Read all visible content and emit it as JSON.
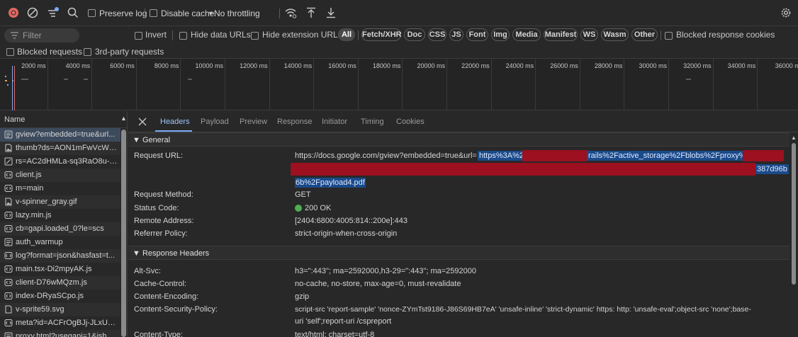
{
  "toolbar": {
    "preserve_log": "Preserve log",
    "disable_cache": "Disable cache",
    "throttling": "No throttling",
    "icons": [
      "record-stop-icon",
      "clear-icon",
      "filter-settings-icon",
      "search-icon",
      "network-conditions-icon",
      "import-har-icon",
      "export-har-icon",
      "settings-icon"
    ],
    "colors": {
      "record": "#e46962",
      "accent": "#7cacf8"
    }
  },
  "filter": {
    "placeholder": "Filter",
    "invert": "Invert",
    "hide_data_urls": "Hide data URLs",
    "hide_extension_urls": "Hide extension URLs",
    "types": [
      "All",
      "Fetch/XHR",
      "Doc",
      "CSS",
      "JS",
      "Font",
      "Img",
      "Media",
      "Manifest",
      "WS",
      "Wasm",
      "Other"
    ],
    "active_type": "All",
    "blocked_response_cookies": "Blocked response cookies",
    "blocked_requests": "Blocked requests",
    "third_party": "3rd-party requests"
  },
  "timeline": {
    "ticks": [
      "2000 ms",
      "4000 ms",
      "6000 ms",
      "8000 ms",
      "10000 ms",
      "12000 ms",
      "14000 ms",
      "16000 ms",
      "18000 ms",
      "20000 ms",
      "22000 ms",
      "24000 ms",
      "26000 ms",
      "28000 ms",
      "30000 ms",
      "32000 ms",
      "34000 ms",
      "36000 m"
    ]
  },
  "requests": {
    "header": "Name",
    "items": [
      {
        "name": "gview?embedded=true&url...",
        "icon": "document-icon"
      },
      {
        "name": "thumb?ds=AON1mFwVcWn...",
        "icon": "image-file-icon"
      },
      {
        "name": "rs=AC2dHMLa-sq3RaO8u-a...",
        "icon": "stylesheet-icon"
      },
      {
        "name": "client.js",
        "icon": "script-icon"
      },
      {
        "name": "m=main",
        "icon": "script-icon"
      },
      {
        "name": "v-spinner_gray.gif",
        "icon": "image-file-icon"
      },
      {
        "name": "lazy.min.js",
        "icon": "script-icon"
      },
      {
        "name": "cb=gapi.loaded_0?le=scs",
        "icon": "script-icon"
      },
      {
        "name": "auth_warmup",
        "icon": "document-icon"
      },
      {
        "name": "log?format=json&hasfast=t...",
        "icon": "fetch-icon"
      },
      {
        "name": "main.tsx-Di2mpyAK.js",
        "icon": "script-icon"
      },
      {
        "name": "client-D76wMQzm.js",
        "icon": "script-icon"
      },
      {
        "name": "index-DRyaSCpo.js",
        "icon": "script-icon"
      },
      {
        "name": "v-sprite59.svg",
        "icon": "file-icon"
      },
      {
        "name": "meta?id=ACFrOgBJj-JLxUGB...",
        "icon": "fetch-icon"
      },
      {
        "name": "proxy.html?usegapi=1&jsh...",
        "icon": "document-icon"
      }
    ]
  },
  "details": {
    "tabs": [
      "Headers",
      "Payload",
      "Preview",
      "Response",
      "Initiator",
      "Timing",
      "Cookies"
    ],
    "active_tab": "Headers",
    "general": {
      "title": "▼ General",
      "request_url_label": "Request URL:",
      "request_url_prefix": "https://docs.google.com/gview?embedded=true&url=",
      "request_url_sel1": "https%3A%2",
      "request_url_sel2": "rails%2Factive_storage%2Fblobs%2Fproxy%2F",
      "request_url_sel3": "387d96b",
      "request_url_line3": "6b%2Fpayload4.pdf",
      "request_method_label": "Request Method:",
      "request_method": "GET",
      "status_code_label": "Status Code:",
      "status_code": "200 OK",
      "status_color": "#4caf50",
      "remote_address_label": "Remote Address:",
      "remote_address": "[2404:6800:4005:814::200e]:443",
      "referrer_policy_label": "Referrer Policy:",
      "referrer_policy": "strict-origin-when-cross-origin"
    },
    "response_headers": {
      "title": "▼ Response Headers",
      "items": [
        {
          "name": "Alt-Svc:",
          "value": "h3=\":443\"; ma=2592000,h3-29=\":443\"; ma=2592000"
        },
        {
          "name": "Cache-Control:",
          "value": "no-cache, no-store, max-age=0, must-revalidate"
        },
        {
          "name": "Content-Encoding:",
          "value": "gzip"
        },
        {
          "name": "Content-Security-Policy:",
          "value": "script-src 'report-sample' 'nonce-ZYmTst9186-J86S69HB7eA' 'unsafe-inline' 'strict-dynamic' https: http: 'unsafe-eval';object-src 'none';base-",
          "value2": "uri 'self';report-uri /cspreport"
        },
        {
          "name": "Content-Type:",
          "value": "text/html; charset=utf-8"
        }
      ]
    }
  }
}
